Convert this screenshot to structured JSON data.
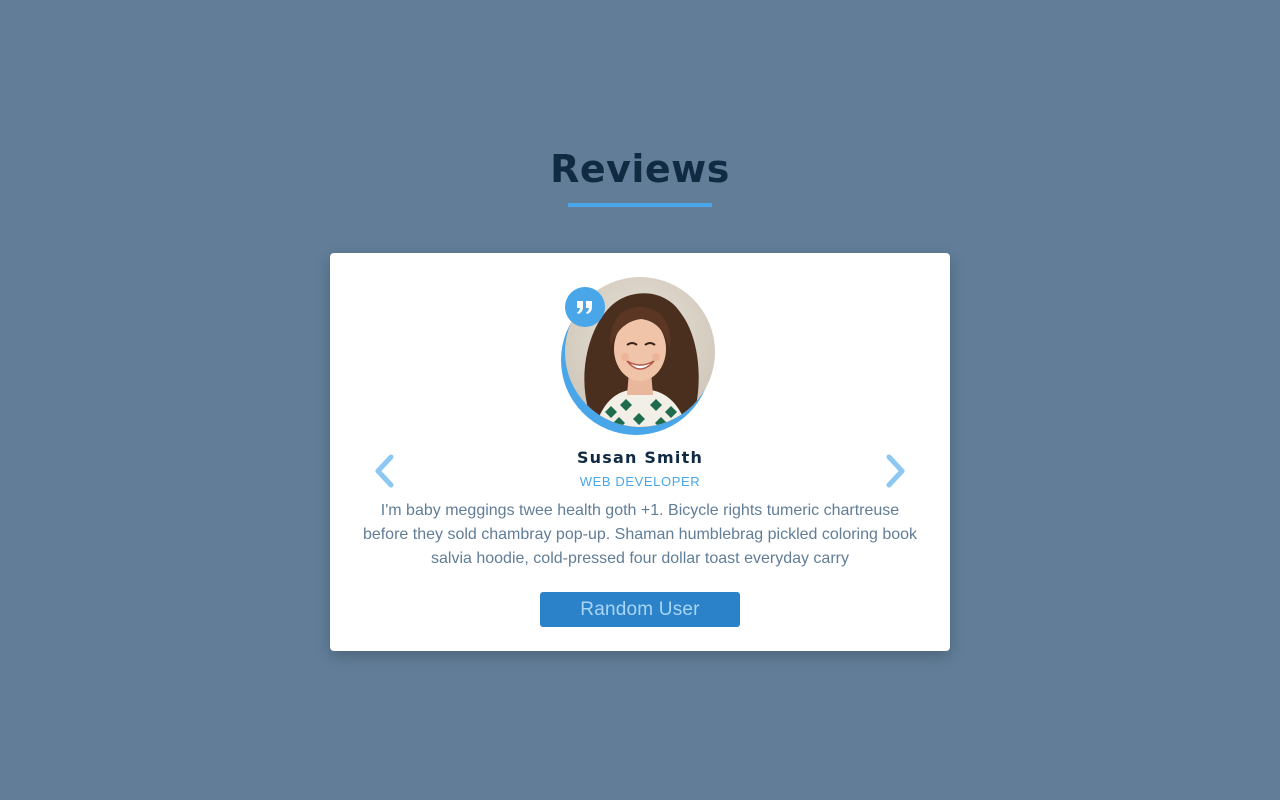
{
  "header": {
    "title": "Reviews"
  },
  "review": {
    "author": "Susan Smith",
    "job": "WEB DEVELOPER",
    "text": "I'm baby meggings twee health goth +1. Bicycle rights tumeric chartreuse before they sold chambray pop-up. Shaman humblebrag pickled coloring book salvia hoodie, cold-pressed four dollar toast everyday carry",
    "image_alt": "Susan Smith"
  },
  "controls": {
    "prev_icon": "chevron-left-icon",
    "next_icon": "chevron-right-icon",
    "random_label": "Random User"
  },
  "colors": {
    "background": "#617d98",
    "primary": "#49a6e9",
    "dark": "#102a42",
    "button": "#2c82c9",
    "button_text": "#a7d5f5"
  }
}
